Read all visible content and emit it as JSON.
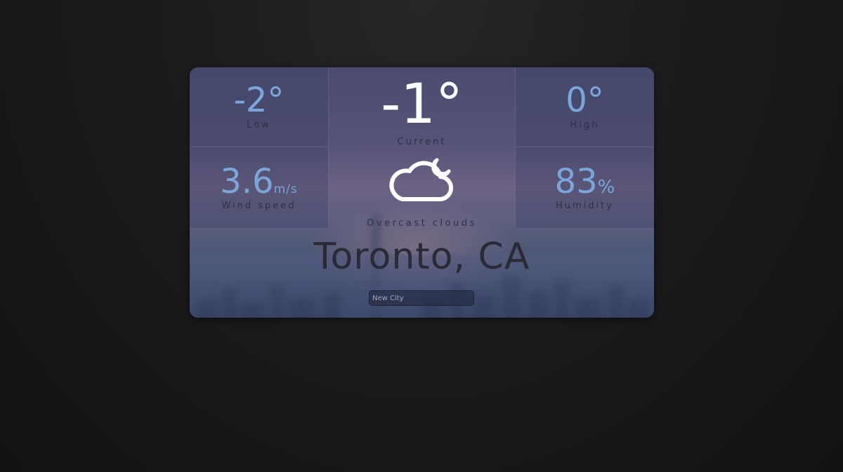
{
  "weather": {
    "low": {
      "value": "-2°",
      "label": "Low"
    },
    "high": {
      "value": "0°",
      "label": "High"
    },
    "wind": {
      "value": "3.6",
      "unit": "m/s",
      "label": "Wind speed"
    },
    "humidity": {
      "value": "83",
      "unit": "%",
      "label": "Humidity"
    },
    "current": {
      "value": "-1°",
      "label": "Current"
    },
    "condition": "Overcast clouds",
    "icon": "cloud-moon-icon",
    "city": "Toronto, CA"
  },
  "search": {
    "placeholder": "New City"
  },
  "colors": {
    "accent": "#7aa6dc",
    "current_text": "#ffffff",
    "label_text": "#2f3044",
    "page_background": "#1b1b1b"
  }
}
